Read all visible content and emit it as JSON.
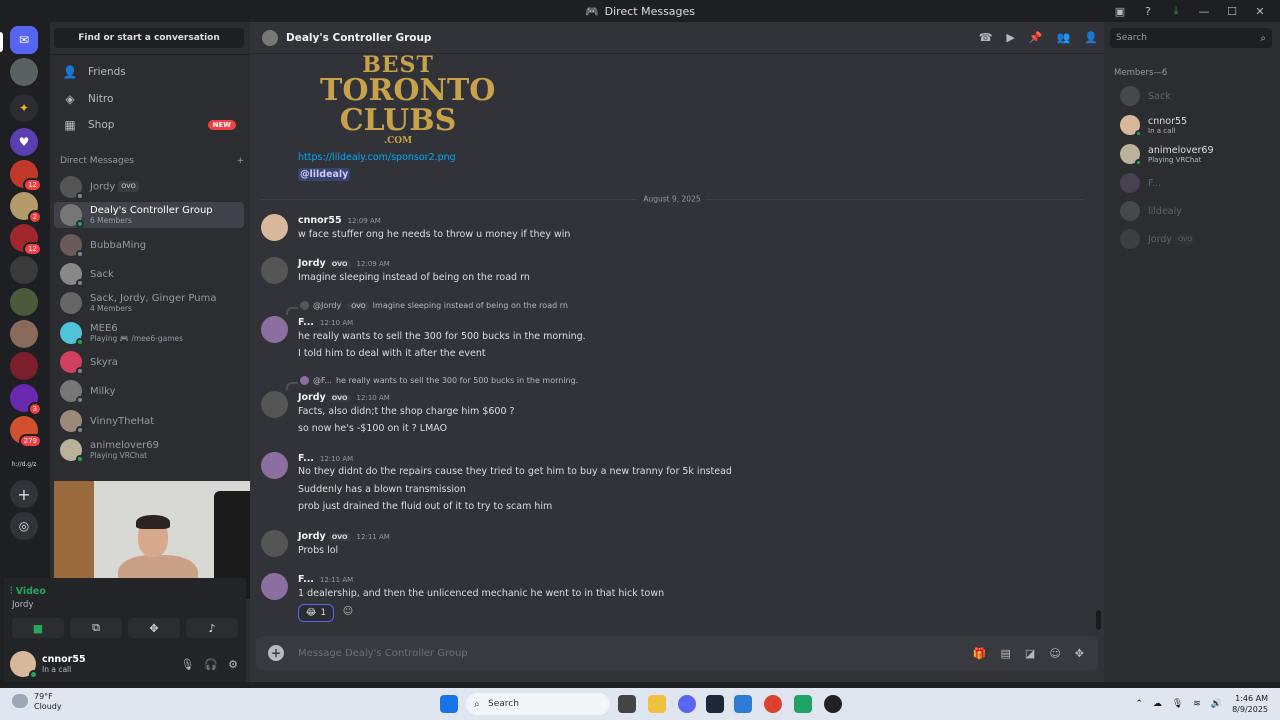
{
  "window": {
    "title": "Direct Messages"
  },
  "dmcolumn": {
    "find_placeholder": "Find or start a conversation",
    "nav": [
      {
        "label": "Friends",
        "icon": "friends-icon"
      },
      {
        "label": "Nitro",
        "icon": "nitro-icon"
      },
      {
        "label": "Shop",
        "icon": "shop-icon",
        "badge": "NEW"
      }
    ],
    "dm_header": "Direct Messages",
    "dm_add": "+",
    "dms": [
      {
        "name": "Jordy",
        "tag": "OVO",
        "sub": ""
      },
      {
        "name": "Dealy's Controller Group",
        "sub": "6 Members"
      },
      {
        "name": "BubbaMing",
        "sub": ""
      },
      {
        "name": "Sack",
        "sub": ""
      },
      {
        "name": "Sack, Jordy, Ginger Puma",
        "sub": "4 Members"
      },
      {
        "name": "MEE6",
        "sub": "Playing 🎮 /mee6-games"
      },
      {
        "name": "Skyra",
        "sub": ""
      },
      {
        "name": "Milky",
        "sub": ""
      },
      {
        "name": "VinnyTheHat",
        "sub": ""
      },
      {
        "name": "animelover69",
        "sub": "Playing VRChat"
      }
    ]
  },
  "voice": {
    "label": "Video",
    "channel": "Jordy"
  },
  "user": {
    "name": "cnnor55",
    "status": "In a call"
  },
  "servers": {
    "badges": [
      "12",
      "2",
      "12",
      "3",
      "279"
    ],
    "label_small": "h://d.g/z"
  },
  "chat": {
    "title": "Dealy's Controller Group",
    "logo": {
      "l1": "BEST",
      "l2": "TORONTO",
      "l3": "CLUBS",
      "l4": ".COM"
    },
    "link": "https://lildealy.com/sponsor2.png",
    "mention": "@lildealy",
    "date": "August 9, 2025",
    "messages": [
      {
        "author": "cnnor55",
        "time": "12:09 AM",
        "lines": [
          "w face stuffer ong he needs to throw u money if they win"
        ]
      },
      {
        "author": "Jordy",
        "tag": "OVO",
        "time": "12:09 AM",
        "lines": [
          "Imagine sleeping instead of being on the road rn"
        ]
      },
      {
        "reply_to": "@Jordy",
        "reply_tag": "OVO",
        "reply_text": "Imagine sleeping instead of being on the road rn",
        "author": "F...",
        "time": "12:10 AM",
        "lines": [
          "he really wants to sell the 300 for 500 bucks in the morning.",
          "I told him to deal with it after the event"
        ]
      },
      {
        "reply_to": "@F...",
        "reply_text": "he really wants to sell the 300 for 500 bucks in the morning.",
        "author": "Jordy",
        "tag": "OVO",
        "time": "12:10 AM",
        "lines": [
          "Facts, also didn;t the shop charge him $600 ?",
          "so now he's -$100 on it ? LMAO"
        ]
      },
      {
        "author": "F...",
        "time": "12:10 AM",
        "lines": [
          "No they didnt do the repairs cause they tried to get him to buy a new tranny for 5k instead",
          "Suddenly has a blown transmission",
          "prob just drained the fluid out of it to try to scam him"
        ]
      },
      {
        "author": "Jordy",
        "tag": "OVO",
        "time": "12:11 AM",
        "lines": [
          "Probs lol"
        ]
      },
      {
        "author": "F...",
        "time": "12:11 AM",
        "lines": [
          "1 dealership, and then the unlicenced mechanic he went to in that hick town"
        ]
      }
    ],
    "reaction_count": "1",
    "composer_placeholder": "Message Dealy's Controller Group"
  },
  "members": {
    "search_placeholder": "Search",
    "header": "Members—6",
    "list": [
      {
        "name": "Sack",
        "sub": "",
        "offline": true
      },
      {
        "name": "cnnor55",
        "sub": "In a call",
        "offline": false
      },
      {
        "name": "animelover69",
        "sub": "Playing VRChat",
        "offline": false
      },
      {
        "name": "F...",
        "sub": "",
        "offline": true
      },
      {
        "name": "lildealy",
        "sub": "",
        "offline": true
      },
      {
        "name": "Jordy",
        "tag": "OVO",
        "sub": "",
        "offline": true
      }
    ]
  },
  "taskbar": {
    "temp": "79°F",
    "condition": "Cloudy",
    "search": "Search",
    "time": "1:46 AM",
    "date": "8/9/2025"
  },
  "colors": {
    "accent": "#5865f2",
    "online": "#23a55a",
    "link": "#00a8fc",
    "badge": "#f23f43"
  }
}
